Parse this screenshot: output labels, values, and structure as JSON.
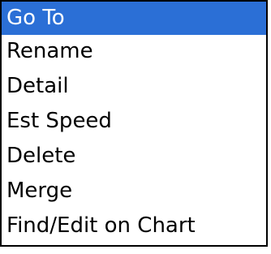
{
  "context_menu": {
    "items": [
      {
        "label": "Go To",
        "selected": true
      },
      {
        "label": "Rename",
        "selected": false
      },
      {
        "label": "Detail",
        "selected": false
      },
      {
        "label": "Est Speed",
        "selected": false
      },
      {
        "label": "Delete",
        "selected": false
      },
      {
        "label": "Merge",
        "selected": false
      },
      {
        "label": "Find/Edit on Chart",
        "selected": false
      }
    ]
  },
  "colors": {
    "selection_background": "#2b6fd6",
    "selection_text": "#ffffff",
    "text": "#000000",
    "background": "#ffffff",
    "border": "#000000"
  }
}
